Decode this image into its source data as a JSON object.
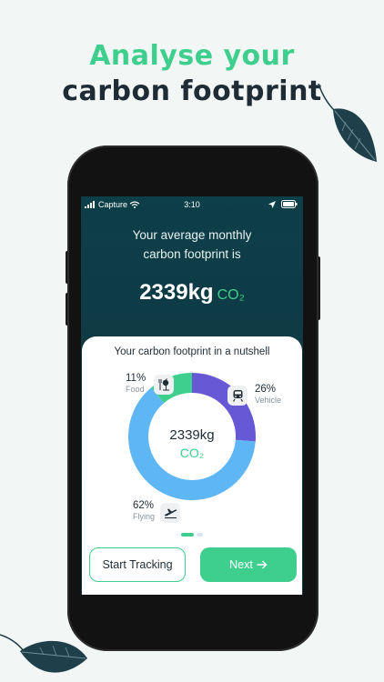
{
  "marketing": {
    "headline_line1": "Analyse your",
    "headline_line2": "carbon footprint"
  },
  "status_bar": {
    "carrier": "Capture",
    "time": "3:10"
  },
  "hero": {
    "line1": "Your average monthly",
    "line2": "carbon footprint is",
    "value": "2339kg",
    "unit": "CO₂"
  },
  "card": {
    "title": "Your carbon footprint in a nutshell",
    "center_value": "2339kg",
    "center_unit": "CO₂",
    "categories": [
      {
        "name": "Food",
        "percent": "11%",
        "icon": "food-icon",
        "color": "#3ecf8e"
      },
      {
        "name": "Vehicle",
        "percent": "26%",
        "icon": "train-icon",
        "color": "#6759d6"
      },
      {
        "name": "Flying",
        "percent": "62%",
        "icon": "plane-icon",
        "color": "#5fb6f5"
      }
    ],
    "page_indicator": {
      "current": 1,
      "total": 2
    }
  },
  "buttons": {
    "start_tracking": "Start Tracking",
    "next": "Next"
  },
  "colors": {
    "accent": "#3ecf8e",
    "dark_text": "#1f2b35",
    "screen_bg": "#0f3a44"
  }
}
